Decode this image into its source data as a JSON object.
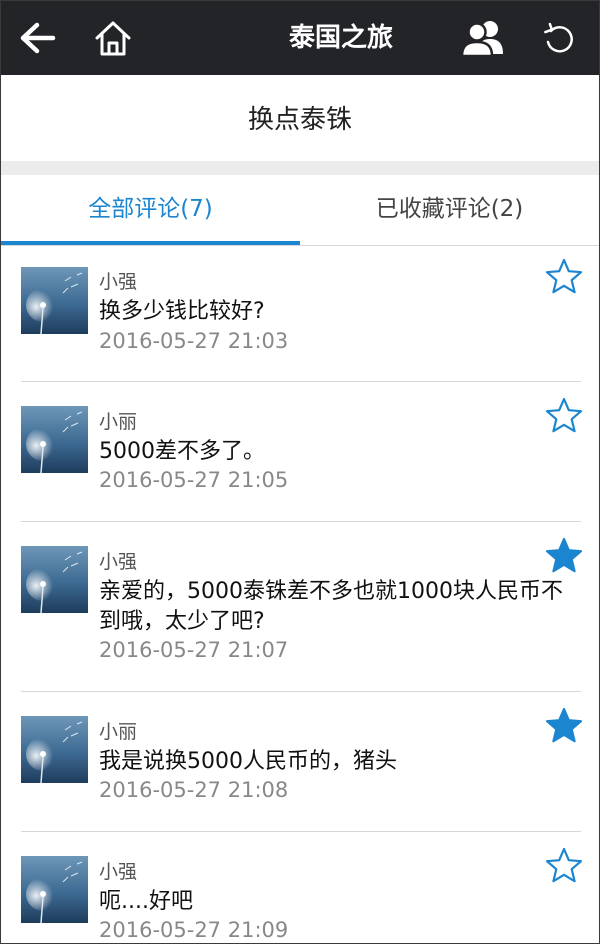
{
  "topbar": {
    "title": "泰国之旅",
    "back_icon": "back-arrow-icon",
    "home_icon": "home-icon",
    "users_icon": "users-icon",
    "refresh_icon": "refresh-icon"
  },
  "subheader": {
    "title": "换点泰铢"
  },
  "tabs": [
    {
      "label": "全部评论(7)",
      "active": true
    },
    {
      "label": "已收藏评论(2)",
      "active": false
    }
  ],
  "colors": {
    "accent": "#1b86cf",
    "topbar": "#222428",
    "star": "#1b86cf"
  },
  "comments": [
    {
      "author": "小强",
      "text": "换多少钱比较好?",
      "time": "2016-05-27 21:03",
      "starred": false
    },
    {
      "author": "小丽",
      "text": "5000差不多了。",
      "time": "2016-05-27 21:05",
      "starred": false
    },
    {
      "author": "小强",
      "text": "亲爱的，5000泰铢差不多也就1000块人民币不到哦，太少了吧?",
      "time": "2016-05-27 21:07",
      "starred": true
    },
    {
      "author": "小丽",
      "text": "我是说换5000人民币的，猪头",
      "time": "2016-05-27 21:08",
      "starred": true
    },
    {
      "author": "小强",
      "text": "呃....好吧",
      "time": "2016-05-27 21:09",
      "starred": false
    }
  ]
}
